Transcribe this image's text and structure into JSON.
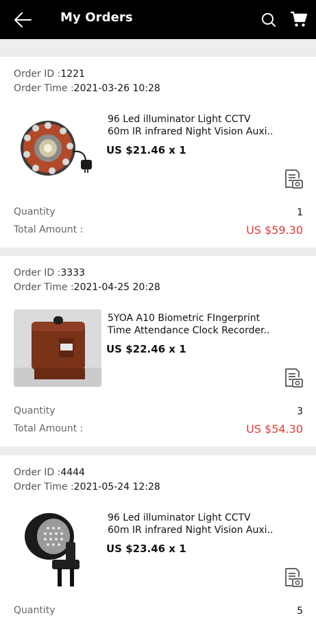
{
  "header": {
    "title": "My Orders"
  },
  "labels": {
    "order_id": "Order ID :",
    "order_time": "Order Time :",
    "quantity": "Quantity",
    "total_amount": "Total Amount :"
  },
  "orders": [
    {
      "id": "1221",
      "time": "2021-03-26 10:28",
      "product_name": "96 Led illuminator Light CCTV\n 60m IR infrared Night Vision Auxi..",
      "price": "US $21.46 x 1",
      "quantity": "1",
      "total": "US $59.30"
    },
    {
      "id": "3333",
      "time": "2021-04-25 20:28",
      "product_name": "5YOA A10 Biometric FIngerprint\n Time Attendance Clock Recorder..",
      "price": "US $22.46 x 1",
      "quantity": "3",
      "total": "US $54.30"
    },
    {
      "id": "4444",
      "time": "2021-05-24 12:28",
      "product_name": "96 Led illuminator Light CCTV\n 60m IR infrared Night Vision Auxi..",
      "price": "US $23.46 x 1",
      "quantity": "5",
      "total": ""
    }
  ],
  "colors": {
    "header_bg": "#000000",
    "accent_price": "#e53935",
    "page_bg": "#ededed"
  },
  "icons": {
    "back": "arrow-left-icon",
    "search": "search-icon",
    "cart": "shopping-cart-icon",
    "receipt": "receipt-photo-icon"
  }
}
